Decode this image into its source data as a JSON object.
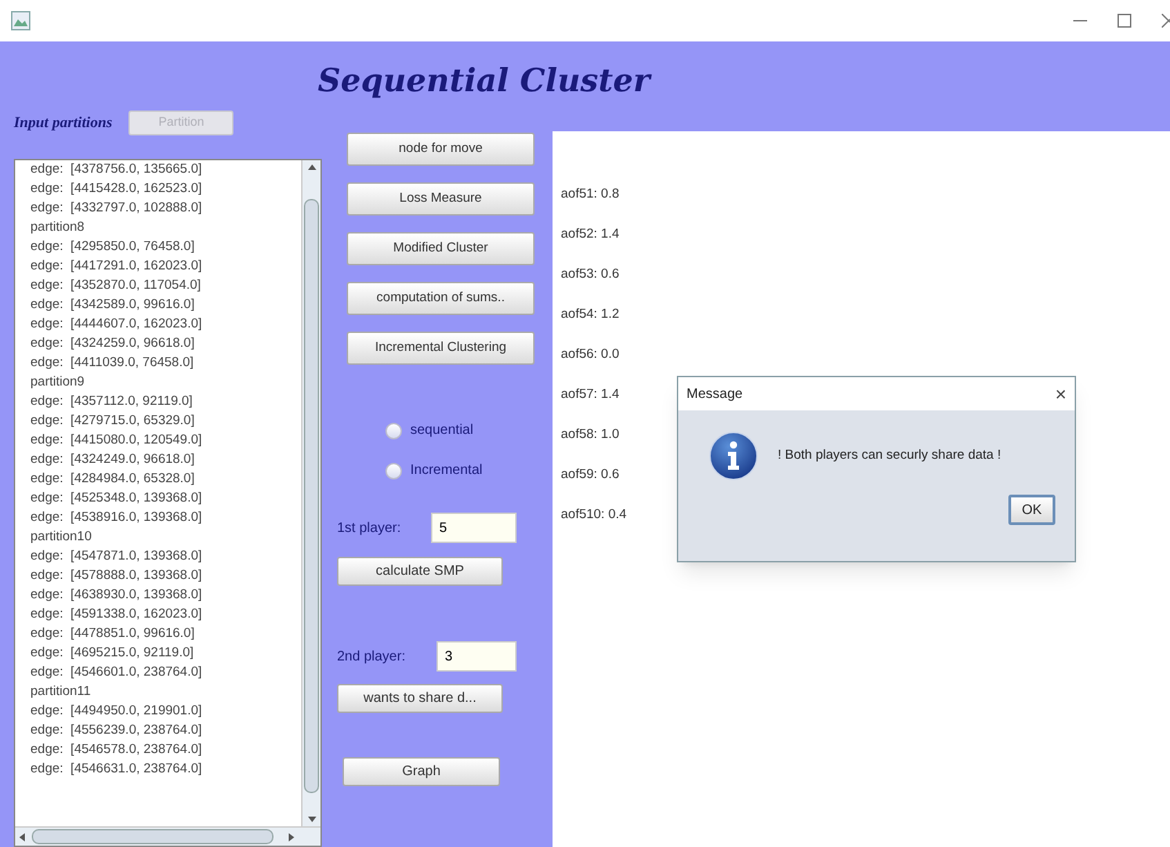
{
  "app_title": "Sequential Cluster",
  "input_label": "Input partitions",
  "partition_button": {
    "label": "Partition",
    "disabled": true
  },
  "list_lines": [
    "edge:  [4378756.0, 135665.0]",
    "edge:  [4415428.0, 162523.0]",
    "edge:  [4332797.0, 102888.0]",
    "partition8",
    "edge:  [4295850.0, 76458.0]",
    "edge:  [4417291.0, 162023.0]",
    "edge:  [4352870.0, 117054.0]",
    "edge:  [4342589.0, 99616.0]",
    "edge:  [4444607.0, 162023.0]",
    "edge:  [4324259.0, 96618.0]",
    "edge:  [4411039.0, 76458.0]",
    "partition9",
    "edge:  [4357112.0, 92119.0]",
    "edge:  [4279715.0, 65329.0]",
    "edge:  [4415080.0, 120549.0]",
    "edge:  [4324249.0, 96618.0]",
    "edge:  [4284984.0, 65328.0]",
    "edge:  [4525348.0, 139368.0]",
    "edge:  [4538916.0, 139368.0]",
    "partition10",
    "edge:  [4547871.0, 139368.0]",
    "edge:  [4578888.0, 139368.0]",
    "edge:  [4638930.0, 139368.0]",
    "edge:  [4591338.0, 162023.0]",
    "edge:  [4478851.0, 99616.0]",
    "edge:  [4695215.0, 92119.0]",
    "edge:  [4546601.0, 238764.0]",
    "partition11",
    "edge:  [4494950.0, 219901.0]",
    "edge:  [4556239.0, 238764.0]",
    "edge:  [4546578.0, 238764.0]",
    "edge:  [4546631.0, 238764.0]"
  ],
  "action_buttons": [
    "node for move",
    "Loss Measure",
    "Modified Cluster",
    "computation of sums..",
    "Incremental Clustering"
  ],
  "radios": [
    {
      "label": "sequential",
      "selected": false
    },
    {
      "label": "Incremental",
      "selected": false
    }
  ],
  "player1": {
    "label": "1st player:",
    "value": "5"
  },
  "smp_button": "calculate SMP",
  "player2": {
    "label": "2nd player:",
    "value": "3"
  },
  "share_button": "wants to share d...",
  "graph_button": "Graph",
  "results": [
    "aof51: 0.8",
    "aof52: 1.4",
    "aof53: 0.6",
    "aof54: 1.2",
    "aof56: 0.0",
    "aof57: 1.4",
    "aof58: 1.0",
    "aof59: 0.6",
    "aof510: 0.4"
  ],
  "dialog": {
    "title": "Message",
    "close": "×",
    "message": "! Both players can securly share data !",
    "ok": "OK"
  }
}
